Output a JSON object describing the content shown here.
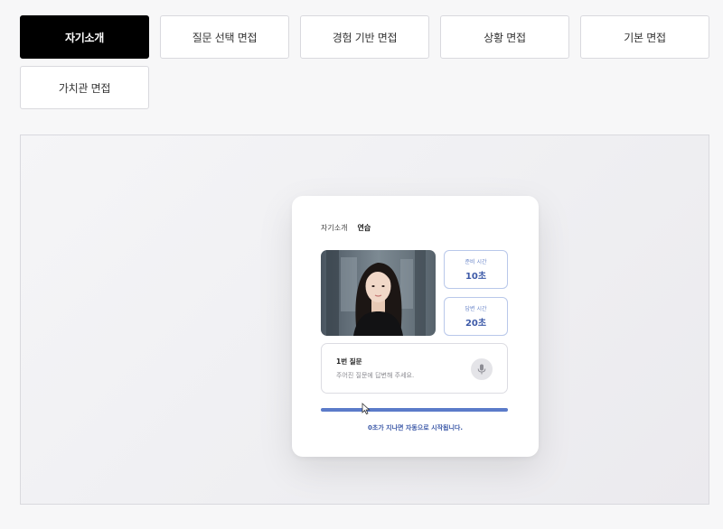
{
  "tabs": [
    {
      "label": "자기소개",
      "active": true
    },
    {
      "label": "질문 선택 면접",
      "active": false
    },
    {
      "label": "경험 기반 면접",
      "active": false
    },
    {
      "label": "상황 면접",
      "active": false
    },
    {
      "label": "기본 면접",
      "active": false
    },
    {
      "label": "가치관 면접",
      "active": false
    }
  ],
  "card": {
    "breadcrumb": {
      "category": "자기소개",
      "mode": "연습"
    },
    "prep_time": {
      "label": "준비 시간",
      "value": "10초"
    },
    "answer_time": {
      "label": "답변 시간",
      "value": "20초"
    },
    "question": {
      "title": "1번 질문",
      "prompt": "주어진 질문에 답변해 주세요."
    },
    "progress": 1.0,
    "notice": "0초가 지나면 자동으로 시작됩니다."
  },
  "colors": {
    "accent": "#5b7bc9",
    "accent_text": "#3d5aa8",
    "active_tab": "#000000"
  },
  "icons": {
    "mic": "microphone-icon",
    "cursor": "mouse-cursor-icon"
  }
}
